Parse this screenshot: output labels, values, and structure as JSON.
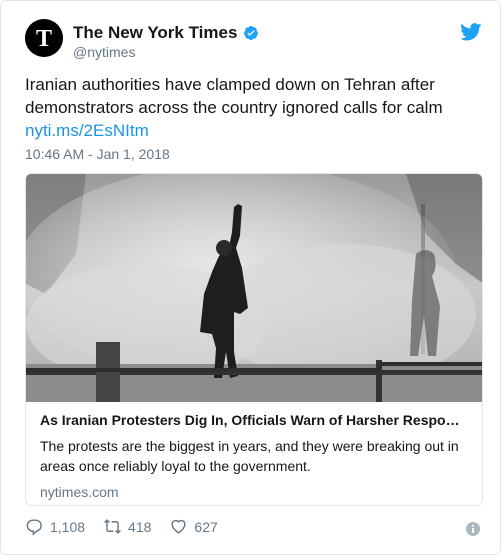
{
  "account": {
    "name": "The New York Times",
    "handle": "@nytimes",
    "avatar_letter": "T"
  },
  "tweet": {
    "text": "Iranian authorities have clamped down on Tehran after demonstrators across the country ignored calls for calm",
    "link": "nyti.ms/2EsNItm",
    "timestamp": "10:46 AM - Jan 1, 2018"
  },
  "card": {
    "title": "As Iranian Protesters Dig In, Officials Warn of Harsher Respo…",
    "description": "The protests are the biggest in years, and they were breaking out in areas once reliably loyal to the government.",
    "domain": "nytimes.com"
  },
  "stats": {
    "replies": "1,108",
    "retweets": "418",
    "likes": "627"
  },
  "icons": {
    "verified": "verified-badge-icon",
    "twitter": "twitter-bird-icon",
    "reply": "reply-icon",
    "retweet": "retweet-icon",
    "like": "heart-icon",
    "info": "info-icon"
  },
  "colors": {
    "link": "#1b95e0",
    "verified": "#1da1f2",
    "muted": "#657786"
  }
}
